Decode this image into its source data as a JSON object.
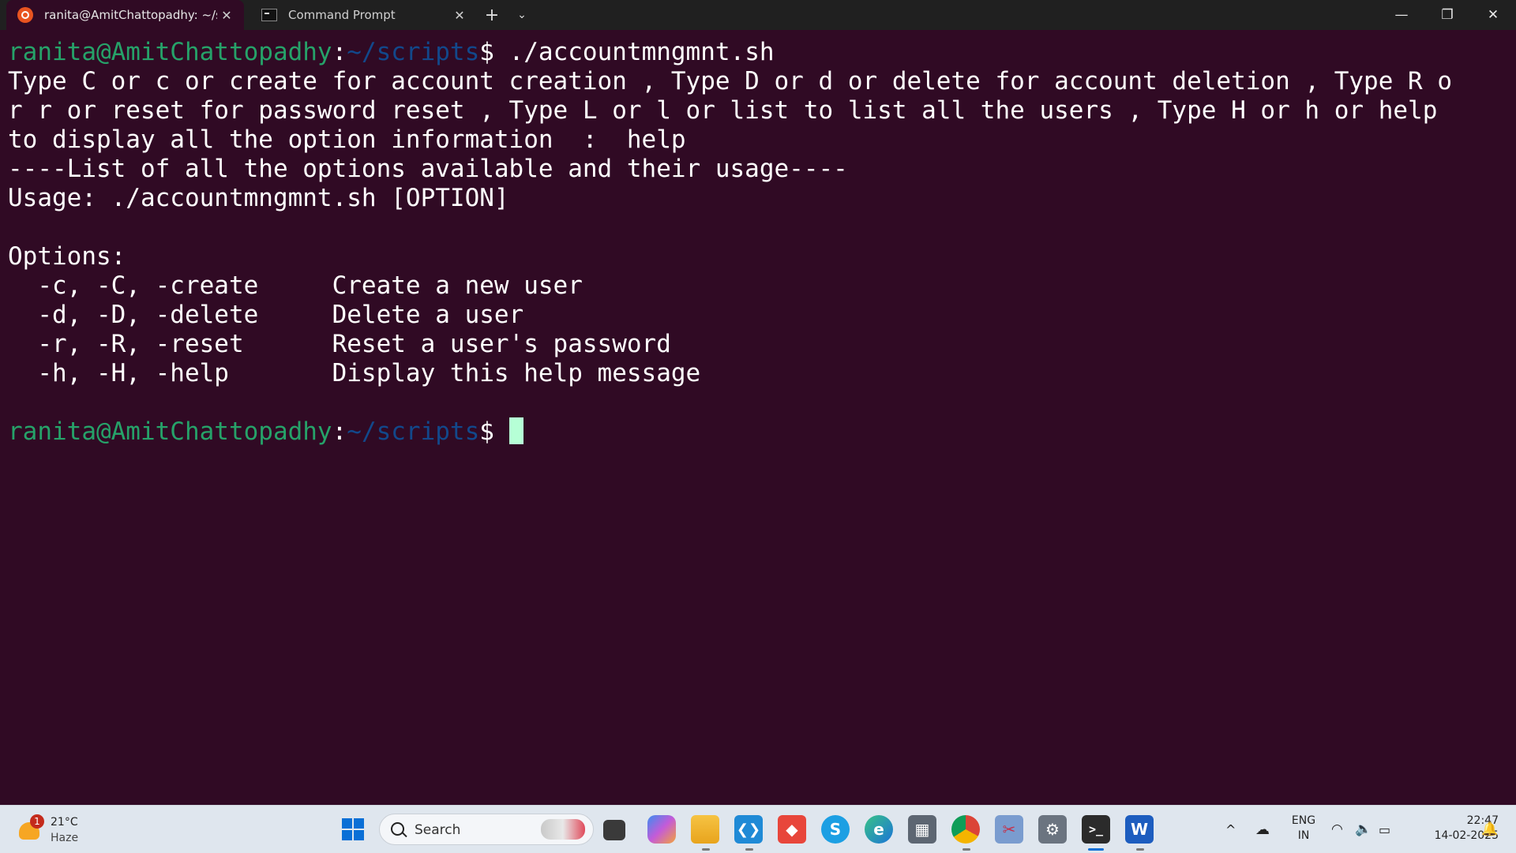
{
  "window": {
    "tabs": [
      {
        "label": "ranita@AmitChattopadhy: ~/s",
        "icon": "ubuntu-icon",
        "active": true
      },
      {
        "label": "Command Prompt",
        "icon": "cmd-icon",
        "active": false
      }
    ],
    "new_tab": "+",
    "dropdown": "⌄",
    "controls": {
      "minimize": "—",
      "maximize": "❐",
      "close": "✕"
    }
  },
  "terminal": {
    "prompt_user": "ranita@AmitChattopadhy",
    "prompt_sep": ":",
    "prompt_path": "~/scripts",
    "prompt_symbol": "$ ",
    "command": "./accountmngmnt.sh",
    "output_lines": [
      "Type C or c or create for account creation , Type D or d or delete for account deletion , Type R o",
      "r r or reset for password reset , Type L or l or list to list all the users , Type H or h or help",
      "to display all the option information  :  help",
      "----List of all the options available and their usage----",
      "Usage: ./accountmngmnt.sh [OPTION]",
      "",
      "Options:",
      "  -c, -C, -create     Create a new user",
      "  -d, -D, -delete     Delete a user",
      "  -r, -R, -reset      Reset a user's password",
      "  -h, -H, -help       Display this help message",
      ""
    ],
    "colors": {
      "background": "#300a24",
      "user": "#26a269",
      "path": "#12488b",
      "cursor": "#b6ffd6"
    }
  },
  "taskbar": {
    "weather": {
      "temp": "21°C",
      "condition": "Haze",
      "badge": "1"
    },
    "search_placeholder": "Search",
    "apps": [
      {
        "name": "task-view-icon",
        "glyph": "▇"
      },
      {
        "name": "copilot-icon",
        "glyph": "✦"
      },
      {
        "name": "file-explorer-icon",
        "glyph": "▬"
      },
      {
        "name": "vscode-icon",
        "glyph": "❮❯"
      },
      {
        "name": "anydesk-icon",
        "glyph": "◆"
      },
      {
        "name": "skype-icon",
        "glyph": "S"
      },
      {
        "name": "edge-icon",
        "glyph": "e"
      },
      {
        "name": "calculator-icon",
        "glyph": "▦"
      },
      {
        "name": "chrome-icon",
        "glyph": "●"
      },
      {
        "name": "snipping-tool-icon",
        "glyph": "✂"
      },
      {
        "name": "settings-icon",
        "glyph": "⚙"
      },
      {
        "name": "terminal-icon",
        "glyph": ">_"
      },
      {
        "name": "word-icon",
        "glyph": "W"
      }
    ],
    "tray": {
      "chevron": "^",
      "lang_top": "ENG",
      "lang_bottom": "IN",
      "time": "22:47",
      "date": "14-02-2025"
    }
  }
}
